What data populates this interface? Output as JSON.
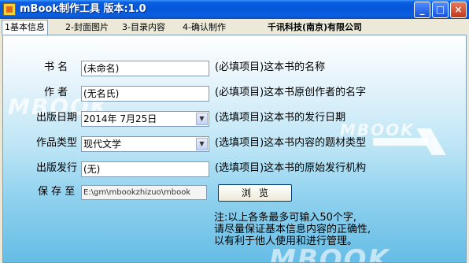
{
  "window": {
    "title": "mBook制作工具  版本:1.0"
  },
  "tabs": [
    {
      "label": "1基本信息"
    },
    {
      "label": "2-封面图片"
    },
    {
      "label": "3-目录内容"
    },
    {
      "label": "4-确认制作"
    }
  ],
  "company": "千讯科技(南京)有限公司",
  "watermark": {
    "left": "MBOOK",
    "right": "MBOOK",
    "bottom": "MBOOK"
  },
  "form": {
    "title": {
      "label": "书    名",
      "value": "(未命名)",
      "hint": "(必填项目)这本书的名称"
    },
    "author": {
      "label": "作    者",
      "value": "(无名氏)",
      "hint": "(必填项目)这本书原创作者的名字"
    },
    "date": {
      "label": "出版日期",
      "value": "2014年  7月25日",
      "hint": "(选填项目)这本书的发行日期"
    },
    "genre": {
      "label": "作品类型",
      "value": "现代文学",
      "hint": "(选填项目)这本书内容的题材类型"
    },
    "publisher": {
      "label": "出版发行",
      "value": "(无)",
      "hint": "(选填项目)这本书的原始发行机构"
    },
    "save": {
      "label": "保 存 至",
      "value": "E:\\gm\\mbookzhizuo\\mbook",
      "browse_label": "浏览"
    }
  },
  "note": {
    "line1": "注:以上各条最多可输入50个字,",
    "line2": "请尽量保证基本信息内容的正确性,",
    "line3": "以有利于他人使用和进行管理。"
  },
  "colors": {
    "titlebar": "#0556d8",
    "panel_bottom": "#66bde6"
  }
}
